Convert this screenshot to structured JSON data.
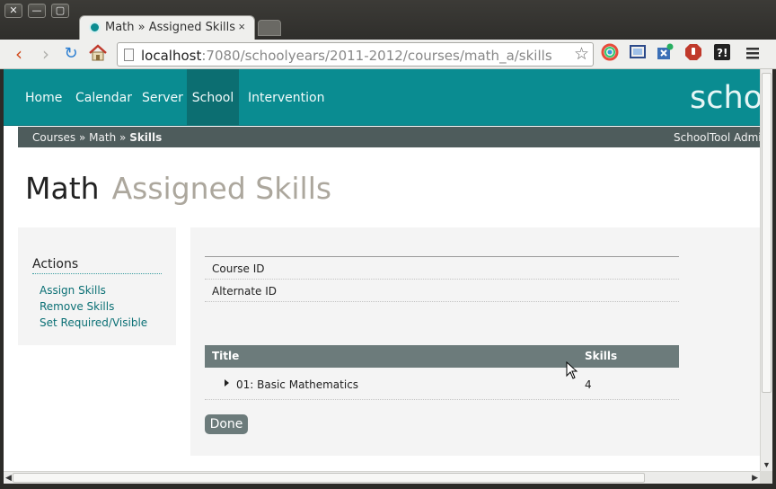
{
  "window": {
    "close_glyph": "✕",
    "minimize_glyph": "—",
    "maximize_glyph": "▢"
  },
  "tab": {
    "title": "Math » Assigned Skills",
    "close_glyph": "×"
  },
  "toolbar": {
    "back_glyph": "‹",
    "forward_glyph": "›",
    "reload_glyph": "↻",
    "url_host": "localhost",
    "url_path": ":7080/schoolyears/2011-2012/courses/math_a/skills",
    "star_glyph": "☆"
  },
  "nav": {
    "items": [
      "Home",
      "Calendar",
      "Server",
      "School",
      "Intervention"
    ],
    "active": "School",
    "brand": "schoo"
  },
  "breadcrumb": {
    "courses": "Courses",
    "sep1": "»",
    "math": "Math",
    "sep2": "»",
    "skills": "Skills",
    "user": "SchoolTool Admin"
  },
  "page": {
    "title_main": "Math",
    "title_sub": "Assigned Skills"
  },
  "actions": {
    "heading": "Actions",
    "links": [
      "Assign Skills",
      "Remove Skills",
      "Set Required/Visible"
    ]
  },
  "details": {
    "fields": [
      "Course ID",
      "Alternate ID"
    ]
  },
  "table": {
    "headers": [
      "Title",
      "Skills"
    ],
    "rows": [
      {
        "title": "01: Basic Mathematics",
        "skills": "4"
      }
    ]
  },
  "buttons": {
    "done": "Done"
  },
  "colors": {
    "accent": "#0a8c91",
    "accent_dark": "#0c6e71",
    "crumbbar": "#4e5c5c",
    "table_header": "#6c7b7b"
  }
}
